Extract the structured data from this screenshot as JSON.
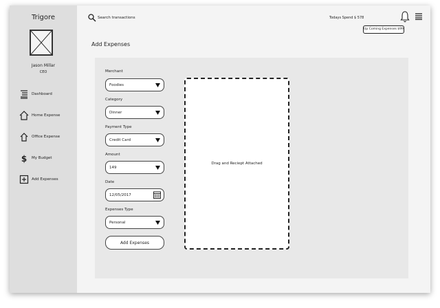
{
  "app": {
    "brand": "Trigore"
  },
  "user": {
    "name": "Jason Millar",
    "role": "CEO"
  },
  "sidebar": {
    "items": [
      {
        "label": "Dashboard",
        "icon": "list-icon"
      },
      {
        "label": "Home Expense",
        "icon": "home-icon"
      },
      {
        "label": "Office Expense",
        "icon": "office-icon"
      },
      {
        "label": "My Budget",
        "icon": "dollar-icon"
      },
      {
        "label": "Add Expenses",
        "icon": "plus-square-icon"
      }
    ]
  },
  "header": {
    "search_placeholder": "Search transactions",
    "todays_spend_label": "Todays Spend",
    "todays_spend_value": "$ 578",
    "upcoming_label": "Up Coming Expenses $99"
  },
  "page": {
    "title": "Add Expenses"
  },
  "form": {
    "merchant": {
      "label": "Merchant",
      "value": "Foodies"
    },
    "category": {
      "label": "Category",
      "value": "Dinner"
    },
    "payment_type": {
      "label": "Payment Type",
      "value": "Credit Card"
    },
    "amount": {
      "label": "Amount",
      "value": "149"
    },
    "date": {
      "label": "Date",
      "value": "12/05/2017"
    },
    "expenses_type": {
      "label": "Expenses Type",
      "value": "Personal"
    },
    "submit_label": "Add Expenses"
  },
  "dropzone": {
    "text": "Drag and Reciept Attached"
  }
}
